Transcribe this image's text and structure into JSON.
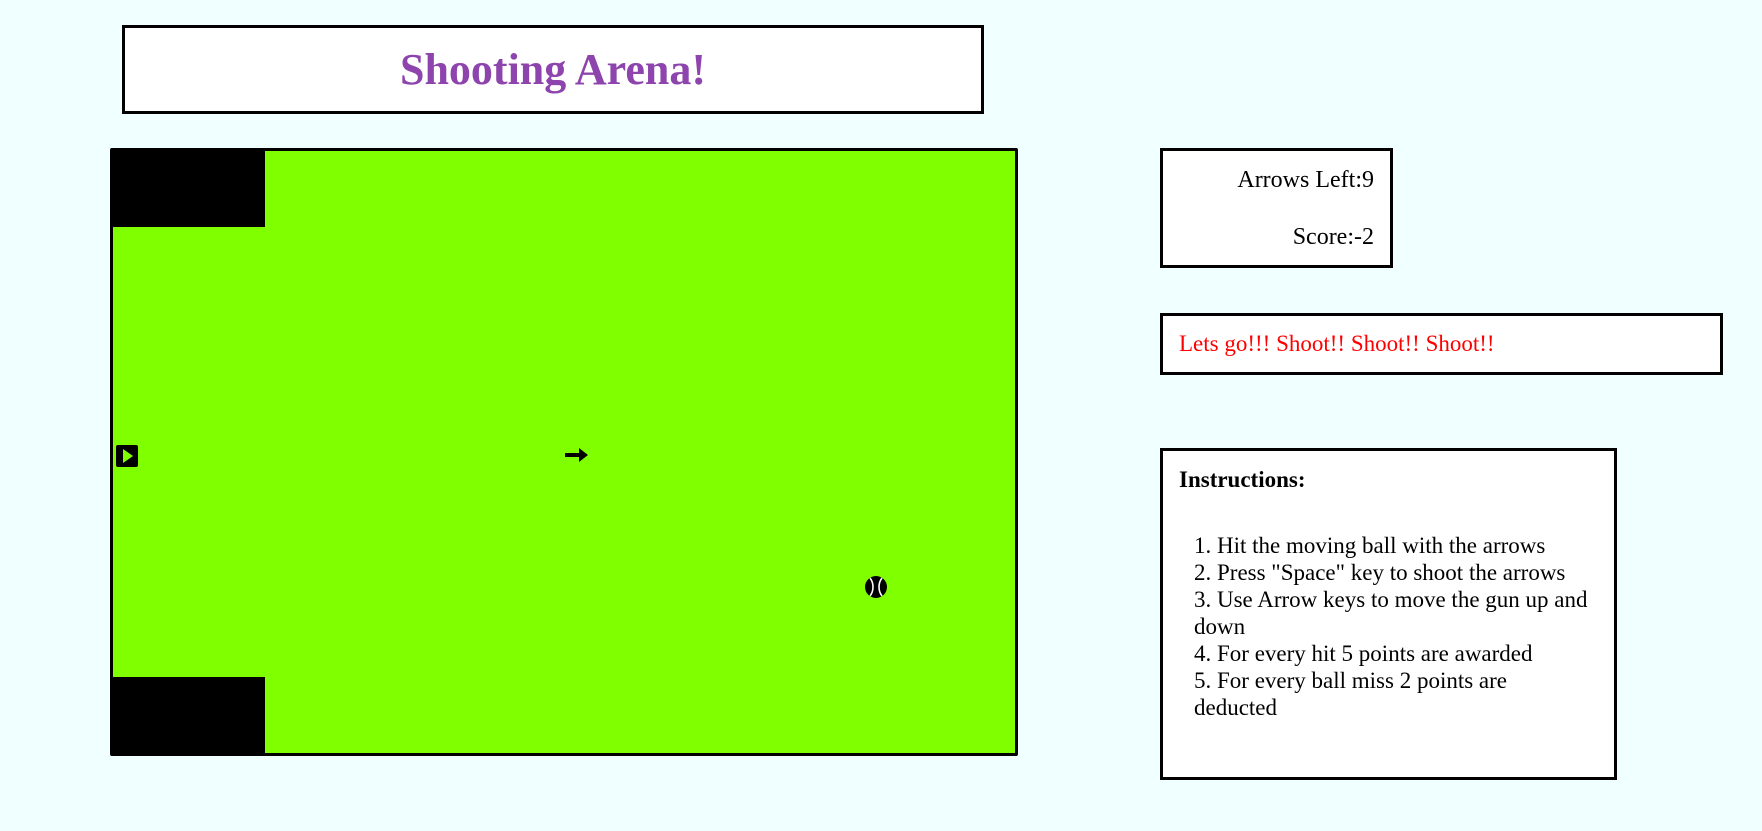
{
  "header": {
    "title": "Shooting Arena!"
  },
  "arena": {
    "background_color": "#7fff00",
    "obstacle_color": "#000000",
    "gun_icon": "play-triangle-icon",
    "arrow_icon": "arrow-right-icon",
    "ball_icon": "tennis-ball-icon"
  },
  "stats": {
    "arrows_left": "Arrows Left:9",
    "score": "Score:-2"
  },
  "message": {
    "text": "Lets go!!! Shoot!! Shoot!! Shoot!!",
    "color": "#ff0000"
  },
  "instructions": {
    "heading": "Instructions:",
    "items": [
      "1. Hit the moving ball with the arrows",
      "2. Press \"Space\" key to shoot the arrows",
      "3. Use Arrow keys to move the gun up and down",
      "4. For every hit 5 points are awarded",
      "5. For every ball miss 2 points are deducted"
    ]
  },
  "colors": {
    "page_background": "#f0ffff",
    "title": "#8e44ad"
  }
}
